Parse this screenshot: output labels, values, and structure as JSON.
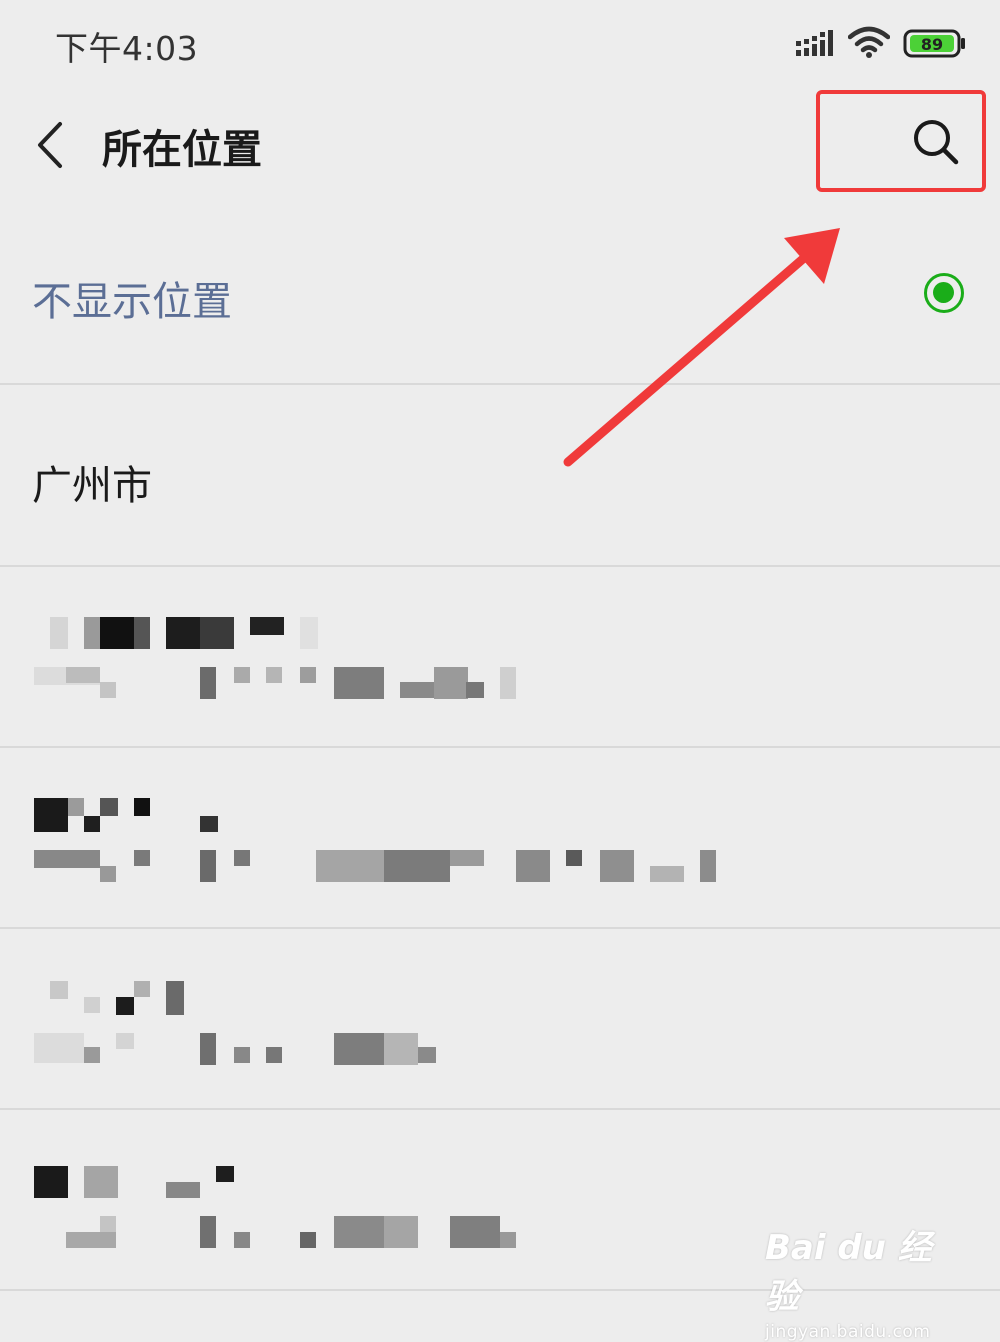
{
  "status_bar": {
    "time": "下午4:03",
    "battery": "89",
    "icons": [
      "signal-icon",
      "wifi-icon",
      "battery-icon"
    ]
  },
  "header": {
    "back_icon": "back-icon",
    "title": "所在位置",
    "search_icon": "search-icon",
    "highlight_color": "#f03a3a"
  },
  "locations": {
    "hide_location_label": "不显示位置",
    "hide_location_selected": true,
    "city_label": "广州市",
    "blurred_rows": 4
  },
  "colors": {
    "accent_green": "#1aad19",
    "link_blue": "#5b6e95",
    "annotation_red": "#f03a3a"
  },
  "watermark": {
    "main": "Bai du 经验",
    "sub": "jingyan.baidu.com"
  }
}
